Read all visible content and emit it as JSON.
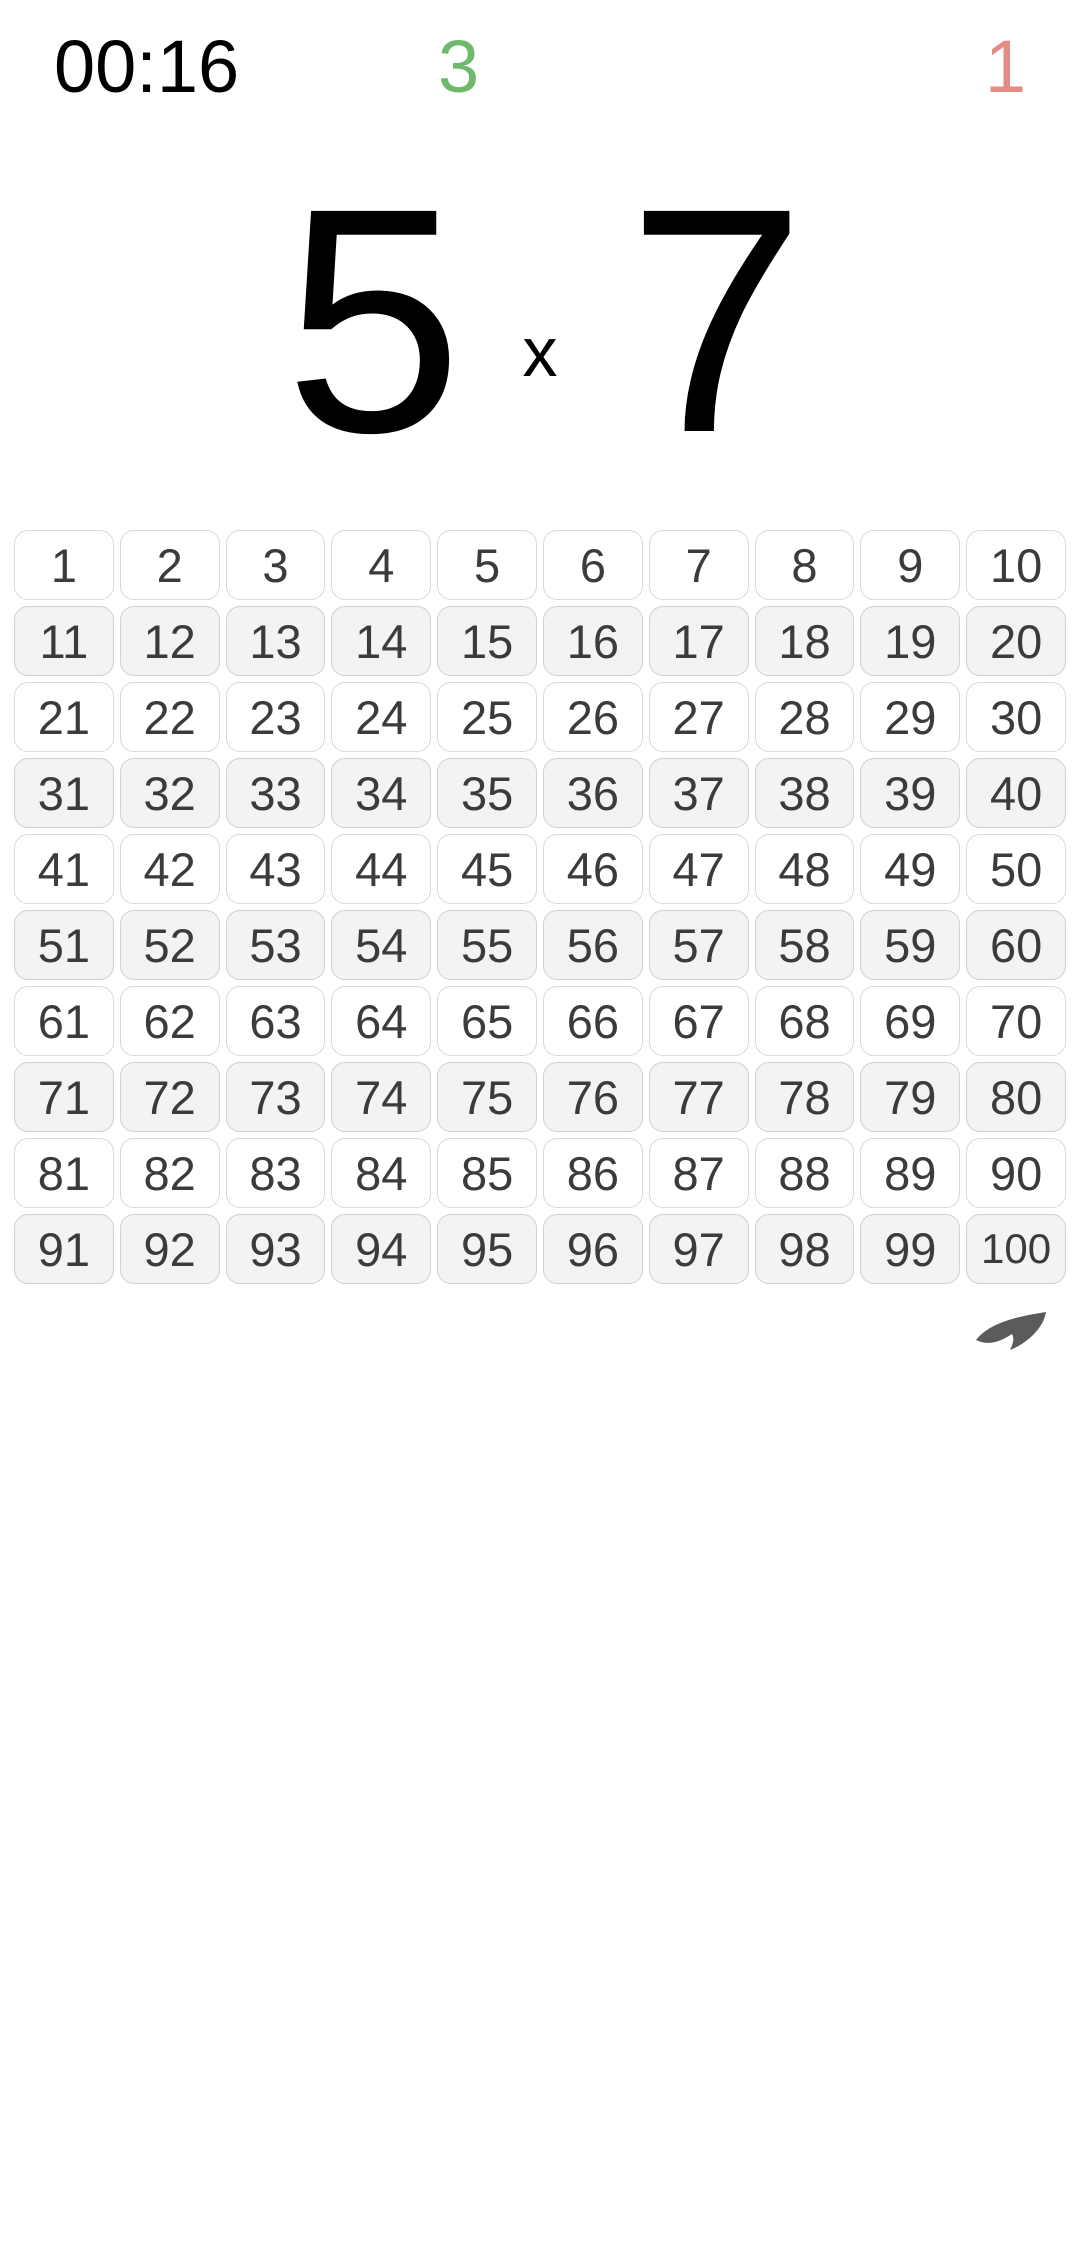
{
  "status": {
    "timer": "00:16",
    "correct": "3",
    "wrong": "1"
  },
  "problem": {
    "left": "5",
    "operator": "x",
    "right": "7"
  },
  "grid": {
    "min": 1,
    "max": 100,
    "cells": [
      "1",
      "2",
      "3",
      "4",
      "5",
      "6",
      "7",
      "8",
      "9",
      "10",
      "11",
      "12",
      "13",
      "14",
      "15",
      "16",
      "17",
      "18",
      "19",
      "20",
      "21",
      "22",
      "23",
      "24",
      "25",
      "26",
      "27",
      "28",
      "29",
      "30",
      "31",
      "32",
      "33",
      "34",
      "35",
      "36",
      "37",
      "38",
      "39",
      "40",
      "41",
      "42",
      "43",
      "44",
      "45",
      "46",
      "47",
      "48",
      "49",
      "50",
      "51",
      "52",
      "53",
      "54",
      "55",
      "56",
      "57",
      "58",
      "59",
      "60",
      "61",
      "62",
      "63",
      "64",
      "65",
      "66",
      "67",
      "68",
      "69",
      "70",
      "71",
      "72",
      "73",
      "74",
      "75",
      "76",
      "77",
      "78",
      "79",
      "80",
      "81",
      "82",
      "83",
      "84",
      "85",
      "86",
      "87",
      "88",
      "89",
      "90",
      "91",
      "92",
      "93",
      "94",
      "95",
      "96",
      "97",
      "98",
      "99",
      "100"
    ]
  },
  "colors": {
    "correct": "#6fb96d",
    "wrong": "#e58b84",
    "cellBorder": "#d9d9d9",
    "cellShaded": "#f3f3f3",
    "back": "#5b5b5b"
  },
  "icons": {
    "back": "back-arrow-icon"
  }
}
